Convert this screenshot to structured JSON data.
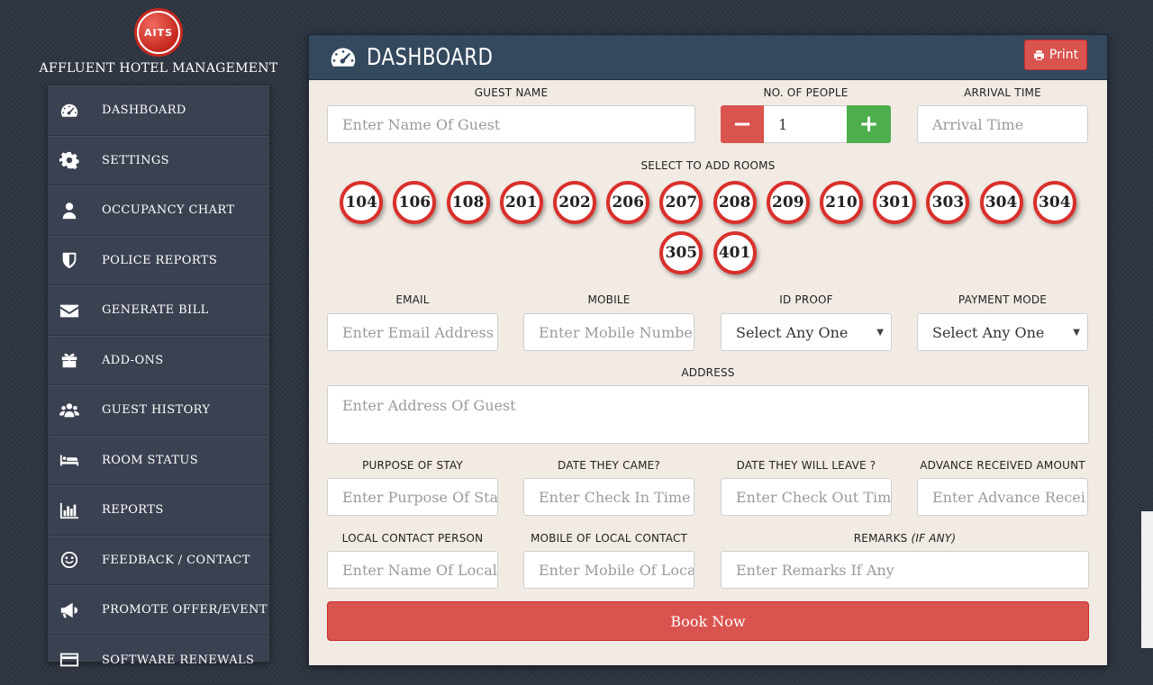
{
  "brand": {
    "logo_text": "AITS",
    "name": "AFFLUENT HOTEL MANAGEMENT"
  },
  "sidebar": {
    "items": [
      {
        "label": "DASHBOARD",
        "icon": "dashboard-icon"
      },
      {
        "label": "SETTINGS",
        "icon": "gear-icon"
      },
      {
        "label": "OCCUPANCY CHART",
        "icon": "user-icon"
      },
      {
        "label": "POLICE REPORTS",
        "icon": "shield-icon"
      },
      {
        "label": "GENERATE BILL",
        "icon": "envelope-icon"
      },
      {
        "label": "ADD-ONS",
        "icon": "gift-icon"
      },
      {
        "label": "GUEST HISTORY",
        "icon": "users-icon"
      },
      {
        "label": "ROOM STATUS",
        "icon": "bed-icon"
      },
      {
        "label": "REPORTS",
        "icon": "bar-chart-icon"
      },
      {
        "label": "FEEDBACK / CONTACT",
        "icon": "smile-icon"
      },
      {
        "label": "PROMOTE OFFER/EVENT",
        "icon": "megaphone-icon"
      },
      {
        "label": "SOFTWARE RENEWALS",
        "icon": "credit-card-icon"
      }
    ]
  },
  "panel": {
    "title": "DASHBOARD",
    "print_label": "Print"
  },
  "form": {
    "guest_name": {
      "label": "GUEST NAME",
      "placeholder": "Enter Name Of Guest"
    },
    "people": {
      "label": "NO. OF PEOPLE",
      "value": "1",
      "minus": "−",
      "plus": "+"
    },
    "arrival": {
      "label": "ARRIVAL TIME",
      "placeholder": "Arrival Time"
    },
    "rooms_label": "SELECT TO ADD ROOMS",
    "rooms": [
      "104",
      "106",
      "108",
      "201",
      "202",
      "206",
      "207",
      "208",
      "209",
      "210",
      "301",
      "303",
      "304",
      "304",
      "305",
      "401"
    ],
    "email": {
      "label": "EMAIL",
      "placeholder": "Enter Email Address"
    },
    "mobile": {
      "label": "MOBILE",
      "placeholder": "Enter Mobile Numbe"
    },
    "id_proof": {
      "label": "ID PROOF",
      "value": "Select Any One"
    },
    "payment": {
      "label": "PAYMENT MODE",
      "value": "Select Any One"
    },
    "address": {
      "label": "ADDRESS",
      "placeholder": "Enter Address Of Guest"
    },
    "purpose": {
      "label": "PURPOSE OF STAY",
      "placeholder": "Enter Purpose Of Sta"
    },
    "came": {
      "label": "DATE THEY CAME?",
      "placeholder": "Enter Check In Time"
    },
    "leave": {
      "label": "DATE THEY WILL LEAVE ?",
      "placeholder": "Enter Check Out Tim"
    },
    "advance": {
      "label": "ADVANCE RECEIVED AMOUNT",
      "placeholder": "Enter Advance Recei"
    },
    "local_person": {
      "label": "LOCAL CONTACT PERSON",
      "placeholder": "Enter Name Of Local"
    },
    "local_mobile": {
      "label": "MOBILE OF LOCAL CONTACT",
      "placeholder": "Enter Mobile Of Loca"
    },
    "remarks": {
      "label": "REMARKS",
      "label_suffix": "(IF ANY)",
      "placeholder": "Enter Remarks If Any"
    },
    "submit": "Book Now"
  }
}
